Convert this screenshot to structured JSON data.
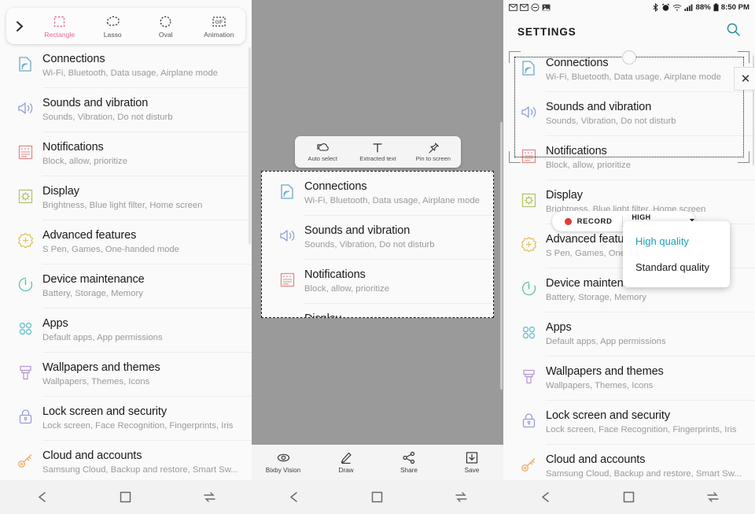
{
  "settings": {
    "header_title": "SETTINGS",
    "items": [
      {
        "title": "Connections",
        "sub": "Wi-Fi, Bluetooth, Data usage, Airplane mode",
        "icon": "connections-icon",
        "color": "#6aa9c8"
      },
      {
        "title": "Sounds and vibration",
        "sub": "Sounds, Vibration, Do not disturb",
        "icon": "sound-icon",
        "color": "#8d9ed6"
      },
      {
        "title": "Notifications",
        "sub": "Block, allow, prioritize",
        "icon": "notifications-icon",
        "color": "#e38b8b"
      },
      {
        "title": "Display",
        "sub": "Brightness, Blue light filter, Home screen",
        "icon": "display-icon",
        "color": "#b6c36b"
      },
      {
        "title": "Advanced features",
        "sub": "S Pen, Games, One-handed mode",
        "icon": "advanced-features-icon",
        "color": "#e0c463"
      },
      {
        "title": "Device maintenance",
        "sub": "Battery, Storage, Memory",
        "icon": "device-maintenance-icon",
        "color": "#63bdb0"
      },
      {
        "title": "Apps",
        "sub": "Default apps, App permissions",
        "icon": "apps-icon",
        "color": "#6fc3cf"
      },
      {
        "title": "Wallpapers and themes",
        "sub": "Wallpapers, Themes, Icons",
        "icon": "wallpaper-icon",
        "color": "#b79ad6"
      },
      {
        "title": "Lock screen and security",
        "sub": "Lock screen, Face Recognition, Fingerprints, Iris",
        "icon": "lock-icon",
        "color": "#9b9ae0"
      },
      {
        "title": "Cloud and accounts",
        "sub": "Samsung Cloud, Backup and restore, Smart Sw...",
        "icon": "key-icon",
        "color": "#e8b070"
      }
    ],
    "truncated_sub_connections": "Wi-Fi, Bluetooth, Data usage, Airplane mode",
    "truncated_sub_display": "Brightness, Blue light filter, Home screen",
    "truncated_advanced_sub": "S Pen, Games, One-",
    "search_icon": "search-icon"
  },
  "smart_select_toolbar": {
    "expand_icon": "chevron-right-icon",
    "items": [
      {
        "label": "Rectangle",
        "icon": "rectangle-select-icon",
        "active": true
      },
      {
        "label": "Lasso",
        "icon": "lasso-select-icon",
        "active": false
      },
      {
        "label": "Oval",
        "icon": "oval-select-icon",
        "active": false
      },
      {
        "label": "Animation",
        "icon": "gif-animation-icon",
        "active": false
      }
    ],
    "active_color": "#e8668a"
  },
  "float_toolbar": {
    "items": [
      {
        "label": "Auto select",
        "icon": "auto-select-icon"
      },
      {
        "label": "Extracted text",
        "icon": "extract-text-icon"
      },
      {
        "label": "Pin to screen",
        "icon": "pin-icon"
      }
    ]
  },
  "action_bar": {
    "items": [
      {
        "label": "Bixby Vision",
        "icon": "bixby-vision-icon"
      },
      {
        "label": "Draw",
        "icon": "draw-icon"
      },
      {
        "label": "Share",
        "icon": "share-icon"
      },
      {
        "label": "Save",
        "icon": "save-icon"
      }
    ]
  },
  "status_bar": {
    "notification_icons": [
      "message-icon",
      "mail-icon",
      "do-not-disturb-icon",
      "image-icon"
    ],
    "system_icons": [
      "bluetooth-icon",
      "alarm-icon",
      "wifi-icon",
      "signal-icon"
    ],
    "battery_percent": "88%",
    "battery_icon": "battery-icon",
    "time": "8:50 PM"
  },
  "selection_overlay": {
    "close_label": "✕",
    "close_icon": "close-icon",
    "handle_icon": "resize-handle-icon"
  },
  "recorder": {
    "record_label": "RECORD",
    "record_dot_color": "#e23b3b",
    "quality_label": "HIGH QUALITY",
    "caret_icon": "chevron-down-icon",
    "menu": {
      "options": [
        {
          "label": "High quality",
          "selected": true
        },
        {
          "label": "Standard quality",
          "selected": false
        }
      ],
      "selected_color": "#17a2b8"
    }
  },
  "navbar": {
    "items": [
      {
        "icon": "back-icon"
      },
      {
        "icon": "home-icon"
      },
      {
        "icon": "recents-icon"
      }
    ]
  }
}
